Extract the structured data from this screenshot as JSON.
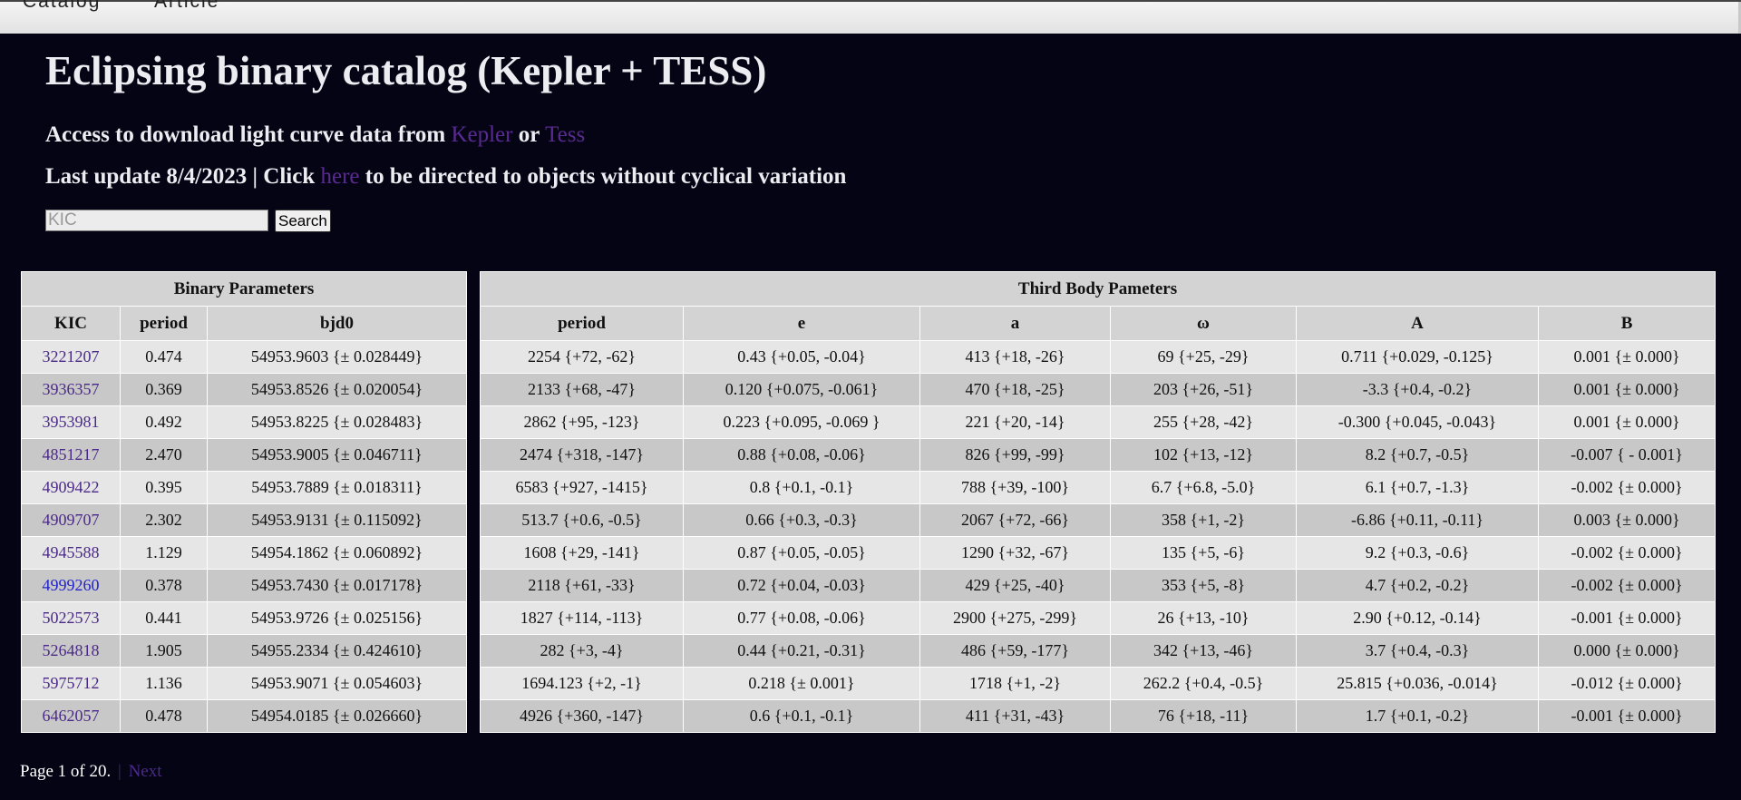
{
  "nav": {
    "items": [
      "Catalog",
      "Article"
    ]
  },
  "header": {
    "title": "Eclipsing binary catalog (Kepler + TESS)",
    "access_prefix": "Access to download light curve data from",
    "kepler_link": "Kepler",
    "or_text": "or",
    "tess_link": "Tess",
    "update_prefix": "Last update 8/4/2023 | Click",
    "here_link": "here",
    "update_suffix": "to be directed to objects without cyclical variation"
  },
  "search": {
    "placeholder": "KIC",
    "value": "",
    "button_label": "Search"
  },
  "binary_table": {
    "group_header": "Binary Parameters",
    "columns": [
      "KIC",
      "period",
      "bjd0"
    ]
  },
  "third_table": {
    "group_header": "Third Body Pameters",
    "columns": [
      "period",
      "e",
      "a",
      "ω",
      "A",
      "B"
    ]
  },
  "rows": [
    {
      "kic": "3221207",
      "period": "0.474",
      "bjd0": "54953.9603 {± 0.028449}",
      "tperiod": "2254 {+72, -62}",
      "e": "0.43 {+0.05, -0.04}",
      "a": "413 {+18, -26}",
      "w": "69 {+25, -29}",
      "A": "0.711 {+0.029, -0.125}",
      "B": "0.001 {± 0.000}"
    },
    {
      "kic": "3936357",
      "period": "0.369",
      "bjd0": "54953.8526 {± 0.020054}",
      "tperiod": "2133 {+68, -47}",
      "e": "0.120 {+0.075, -0.061}",
      "a": "470 {+18, -25}",
      "w": "203 {+26, -51}",
      "A": "-3.3 {+0.4, -0.2}",
      "B": "0.001 {± 0.000}"
    },
    {
      "kic": "3953981",
      "period": "0.492",
      "bjd0": "54953.8225 {± 0.028483}",
      "tperiod": "2862 {+95, -123}",
      "e": "0.223 {+0.095, -0.069 }",
      "a": "221 {+20, -14}",
      "w": "255 {+28, -42}",
      "A": "-0.300 {+0.045, -0.043}",
      "B": "0.001 {± 0.000}"
    },
    {
      "kic": "4851217",
      "period": "2.470",
      "bjd0": "54953.9005 {± 0.046711}",
      "tperiod": "2474 {+318, -147}",
      "e": "0.88 {+0.08, -0.06}",
      "a": "826 {+99, -99}",
      "w": "102 {+13, -12}",
      "A": "8.2 {+0.7, -0.5}",
      "B": "-0.007 { - 0.001}"
    },
    {
      "kic": "4909422",
      "period": "0.395",
      "bjd0": "54953.7889 {± 0.018311}",
      "tperiod": "6583 {+927, -1415}",
      "e": "0.8 {+0.1, -0.1}",
      "a": "788 {+39, -100}",
      "w": "6.7 {+6.8, -5.0}",
      "A": "6.1 {+0.7, -1.3}",
      "B": "-0.002 {± 0.000}"
    },
    {
      "kic": "4909707",
      "period": "2.302",
      "bjd0": "54953.9131 {± 0.115092}",
      "tperiod": "513.7 {+0.6, -0.5}",
      "e": "0.66 {+0.3, -0.3}",
      "a": "2067 {+72, -66}",
      "w": "358 {+1, -2}",
      "A": "-6.86 {+0.11, -0.11}",
      "B": "0.003 {± 0.000}"
    },
    {
      "kic": "4945588",
      "period": "1.129",
      "bjd0": "54954.1862 {± 0.060892}",
      "tperiod": "1608 {+29, -141}",
      "e": "0.87 {+0.05, -0.05}",
      "a": "1290 {+32, -67}",
      "w": "135 {+5, -6}",
      "A": "9.2 {+0.3, -0.6}",
      "B": "-0.002 {± 0.000}"
    },
    {
      "kic": "4999260",
      "period": "0.378",
      "bjd0": "54953.7430 {± 0.017178}",
      "tperiod": "2118 {+61, -33}",
      "e": "0.72 {+0.04, -0.03}",
      "a": "429 {+25, -40}",
      "w": "353 {+5, -8}",
      "A": "4.7 {+0.2, -0.2}",
      "B": "-0.002 {± 0.000}"
    },
    {
      "kic": "5022573",
      "period": "0.441",
      "bjd0": "54953.9726 {± 0.025156}",
      "tperiod": "1827 {+114, -113}",
      "e": "0.77 {+0.08, -0.06}",
      "a": "2900 {+275, -299}",
      "w": "26 {+13, -10}",
      "A": "2.90 {+0.12, -0.14}",
      "B": "-0.001 {± 0.000}"
    },
    {
      "kic": "5264818",
      "period": "1.905",
      "bjd0": "54955.2334 {± 0.424610}",
      "tperiod": "282 {+3, -4}",
      "e": "0.44 {+0.21, -0.31}",
      "a": "486 {+59, -177}",
      "w": "342 {+13, -46}",
      "A": "3.7 {+0.4, -0.3}",
      "B": "0.000 {± 0.000}"
    },
    {
      "kic": "5975712",
      "period": "1.136",
      "bjd0": "54953.9071 {± 0.054603}",
      "tperiod": "1694.123 {+2, -1}",
      "e": "0.218 {± 0.001}",
      "a": "1718 {+1, -2}",
      "w": "262.2 {+0.4, -0.5}",
      "A": "25.815 {+0.036, -0.014}",
      "B": "-0.012 {± 0.000}"
    },
    {
      "kic": "6462057",
      "period": "0.478",
      "bjd0": "54954.0185 {± 0.026660}",
      "tperiod": "4926 {+360, -147}",
      "e": "0.6 {+0.1, -0.1}",
      "a": "411 {+31, -43}",
      "w": "76 {+18, -11}",
      "A": "1.7 {+0.1, -0.2}",
      "B": "-0.001 {± 0.000}"
    }
  ],
  "active_kic": "4999260",
  "pager": {
    "text": "Page 1 of 20.",
    "separator": "|",
    "next_label": "Next"
  },
  "colors": {
    "background": "#050414",
    "link": "#4b2a87",
    "active_link": "#2222cc",
    "row_light": "#e6e6e6",
    "row_dark": "#c8c8c8"
  }
}
